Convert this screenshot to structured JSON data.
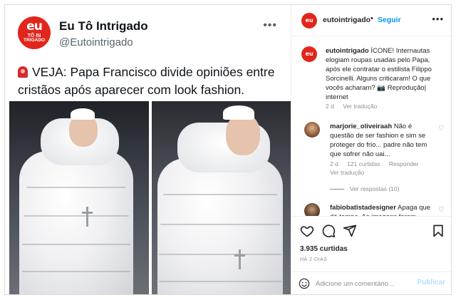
{
  "tweet": {
    "avatar_line1": "eu",
    "avatar_line2": "TÔ IN",
    "avatar_line3": "TRIGADO",
    "name": "Eu Tô Intrigado",
    "handle": "@Eutointrigado",
    "more_icon": "ellipsis-icon",
    "siren_icon": "siren-icon",
    "text": "VEJA: Papa Francisco divide opiniões entre cristãos após aparecer com look fashion."
  },
  "post_header": {
    "avatar_text": "eu",
    "username": "eutointrigado",
    "separator": "•",
    "follow_label": "Seguir",
    "more_icon": "ellipsis-icon"
  },
  "caption": {
    "username": "eutointrigado",
    "text": "ÍCONE! Internautas elogiam roupas usadas pelo Papa, após ele contratar o estilista Filippo Sorcinelli. Alguns criticaram! O que vocês acharam? 📷 Reprodução| internet",
    "age": "2 d",
    "translate": "Ver tradução"
  },
  "comments": [
    {
      "username": "marjorie_oliveiraah",
      "text": "Não é questão de ser fashion e sim se proteger do frio... padre não tem que sofrer não uai...",
      "age": "2 d",
      "likes": "121 curtidas",
      "reply": "Responder",
      "translate": "Ver tradução",
      "replies": "Ver respostas (10)"
    },
    {
      "username": "fabiobatistadesigner",
      "text": "Apaga que dá tempo. As imagens foram criadas"
    }
  ],
  "actions": {
    "like_icon": "heart-icon",
    "comment_icon": "comment-icon",
    "share_icon": "send-icon",
    "save_icon": "bookmark-icon",
    "likes": "3.935 curtidas",
    "posted": "HÁ 2 DIAS"
  },
  "add_comment": {
    "emoji_icon": "emoji-icon",
    "placeholder": "Adicione um comentário...",
    "publish_label": "Publicar"
  },
  "colors": {
    "brand_red": "#e1261c",
    "link_blue": "#0095f6",
    "publish_disabled": "#b2dffc",
    "muted": "#8e8e8e"
  }
}
